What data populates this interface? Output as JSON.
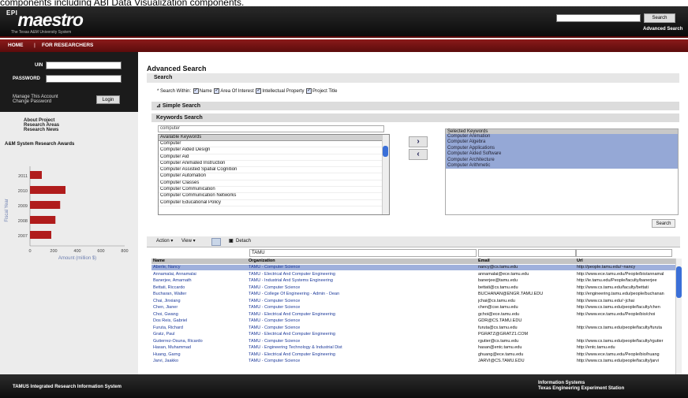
{
  "caption": "components including ABI Data Visualization components.",
  "header": {
    "logo_prefix": "EPI",
    "logo_main": "maestro",
    "logo_sub": "The Texas A&M University System",
    "search_button": "Search",
    "advanced_link": "Advanced Search"
  },
  "nav": {
    "home": "HOME",
    "sep": "|",
    "researchers": "FOR RESEARCHERS"
  },
  "login": {
    "uin_label": "UIN",
    "password_label": "PASSWORD",
    "manage": "Manage This Account",
    "change": "Change Password",
    "login_button": "Login"
  },
  "left_links": [
    "About Project",
    "Research Areas",
    "Research News"
  ],
  "awards_title": "A&M System Research Awards",
  "chart_data": {
    "type": "bar",
    "orientation": "horizontal",
    "categories": [
      "2011",
      "2010",
      "2009",
      "2008",
      "2007"
    ],
    "values": [
      100,
      300,
      255,
      215,
      180
    ],
    "xticks": [
      "0",
      "200",
      "400",
      "600",
      "800"
    ],
    "xlabel": "Amount (million $)",
    "ylabel": "Fiscal Year",
    "xlim": [
      0,
      800
    ]
  },
  "main": {
    "title": "Advanced Search",
    "search_bar": "Search",
    "search_within_label": "* Search Within:",
    "options": [
      "Name",
      "Area Of Interest",
      "Intellectual Property",
      "Project Title"
    ],
    "simple_search": "Simple Search",
    "keywords_search": "Keywords Search",
    "keyword_input": "computer",
    "available_header": "Available Keywords",
    "available": [
      "Computer",
      "Computer Aided Design",
      "Computer Aid",
      "Computer Animated Instruction",
      "Computer Assisted Spatial Cognition",
      "Computer Automation",
      "Computer Classes",
      "Computer Communication",
      "Computer Communication Networks",
      "Computer Educational Policy"
    ],
    "add_arrow": "›",
    "remove_arrow": "‹",
    "selected_header": "Selected Keywords",
    "selected": [
      "Computer Animation",
      "Computer Algebra",
      "Computer Applications",
      "Computer Aided Software",
      "Computer Architecture",
      "Computer Arithmetic"
    ],
    "search_button": "Search",
    "toolbar": {
      "actions": "Action ▾",
      "view": "View ▾",
      "detach": "Detach"
    },
    "filter_value": "TAMU",
    "columns": [
      "Name",
      "Organization",
      "Email",
      "Url"
    ],
    "rows": [
      [
        "Aberle, Nancy",
        "TAMU - Computer Science",
        "nancy@cs.tamu.edu",
        "http://people.tamu.edu/~nancy"
      ],
      [
        "Annamalai, Annamalai",
        "TAMU - Electrical And Computer Engineering",
        "annamalai@ece.tamu.edu",
        "http://www.ece.tamu.edu/People/bio/annamal"
      ],
      [
        "Banerjee, Amarnath",
        "TAMU - Industrial And Systems Engineering",
        "banerjee@tamu.edu",
        "http://ie.tamu.edu/People/faculty/banerjee"
      ],
      [
        "Bettati, Riccardo",
        "TAMU - Computer Science",
        "bettati@cs.tamu.edu",
        "http://www.cs.tamu.edu/faculty/bettati"
      ],
      [
        "Bucharan, Walter",
        "TAMU - College Of Engineering - Admin - Dean",
        "BUCHANAN@ENGR.TAMU.EDU",
        "http://engineering.tamu.edu/people/buchanan"
      ],
      [
        "Chai, Jinxiang",
        "TAMU - Computer Science",
        "jchai@cs.tamu.edu",
        "http://www.cs.tamu.edu/~jchai"
      ],
      [
        "Chen, Jianer",
        "TAMU - Computer Science",
        "chen@cse.tamu.edu",
        "http://www.cs.tamu.edu/people/faculty/chen"
      ],
      [
        "Choi, Gwang",
        "TAMU - Electrical And Computer Engineering",
        "gchoi@ece.tamu.edu",
        "http://www.ece.tamu.edu/People/bio/choi"
      ],
      [
        "Dos Reis, Gabriel",
        "TAMU - Computer Science",
        "GDR@CS.TAMU.EDU",
        ""
      ],
      [
        "Furuta, Richard",
        "TAMU - Computer Science",
        "furuta@cs.tamu.edu",
        "http://www.cs.tamu.edu/people/faculty/furuta"
      ],
      [
        "Gratz, Paul",
        "TAMU - Electrical And Computer Engineering",
        "PGRATZ@GRATZ1.COM",
        ""
      ],
      [
        "Gutierrez-Osuna, Ricardo",
        "TAMU - Computer Science",
        "rgutier@cs.tamu.edu",
        "http://www.cs.tamu.edu/people/faculty/rgutier"
      ],
      [
        "Hasan, Muhammad",
        "TAMU - Engineering Technology & Industrial Dist",
        "hasan@entc.tamu.edu",
        "http://entc.tamu.edu"
      ],
      [
        "Huang, Garng",
        "TAMU - Electrical And Computer Engineering",
        "ghuang@ece.tamu.edu",
        "http://www.ece.tamu.edu/People/bio/huang"
      ],
      [
        "Jarvi, Jaakko",
        "TAMU - Computer Science",
        "JARVI@CS.TAMU.EDU",
        "http://www.cs.tamu.edu/people/faculty/jarvi"
      ]
    ]
  },
  "footer": {
    "left": "TAMUS Integrated Research Information System",
    "right1": "Information Systems",
    "right2": "Texas Engineering Experiment Station"
  }
}
